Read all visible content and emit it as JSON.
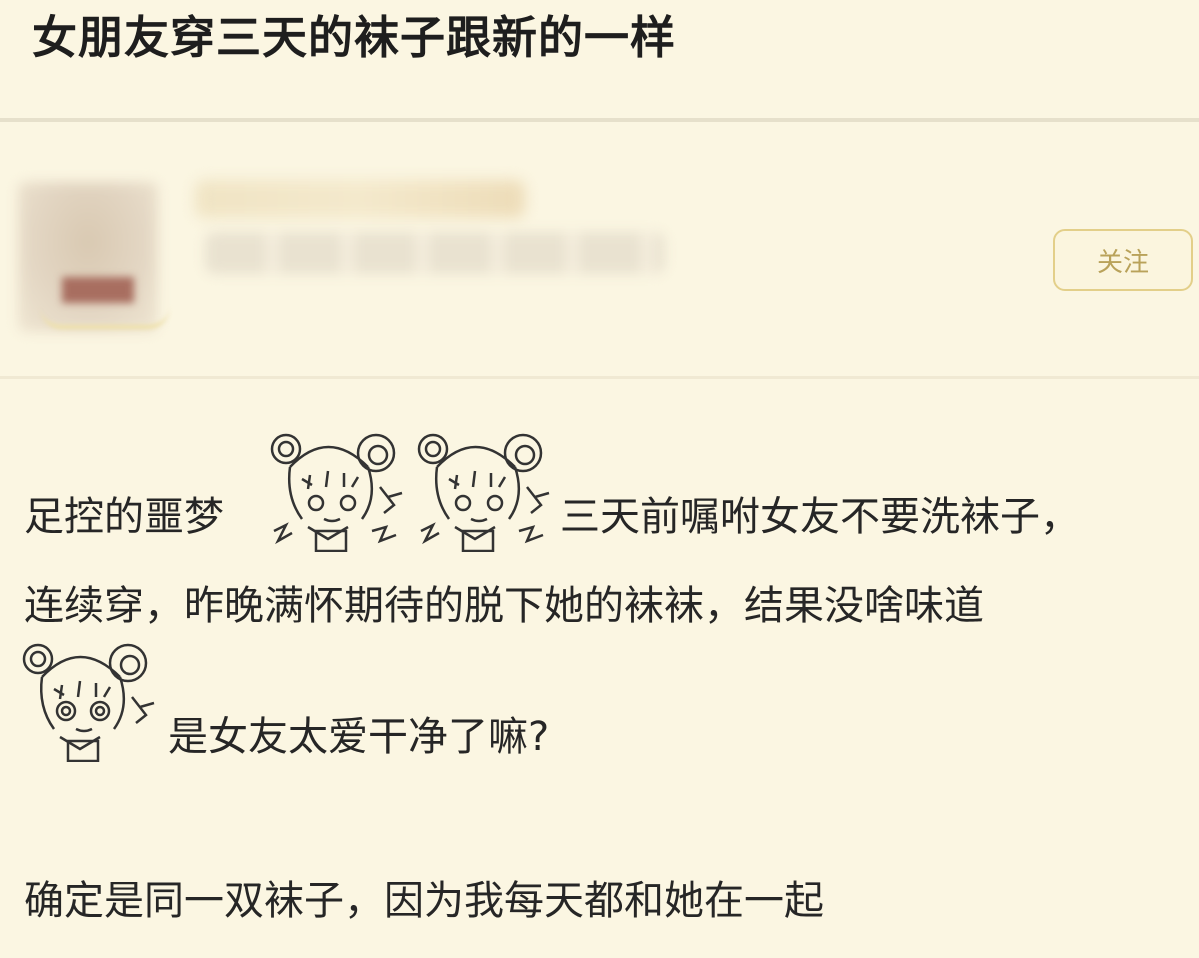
{
  "post": {
    "title": "女朋友穿三天的袜子跟新的一样",
    "follow_label": "关注",
    "body": {
      "line1_a": "足控的噩梦",
      "line1_b": "三天前嘱咐女友不要洗袜子，",
      "line2": "连续穿，昨晚满怀期待的脱下她的袜袜，结果没啥味道",
      "line3": "是女友太爱干净了嘛?",
      "line4": "确定是同一双袜子，因为我每天都和她在一起"
    }
  },
  "icons": {
    "sticker": "anime-girl-sticker-icon"
  }
}
